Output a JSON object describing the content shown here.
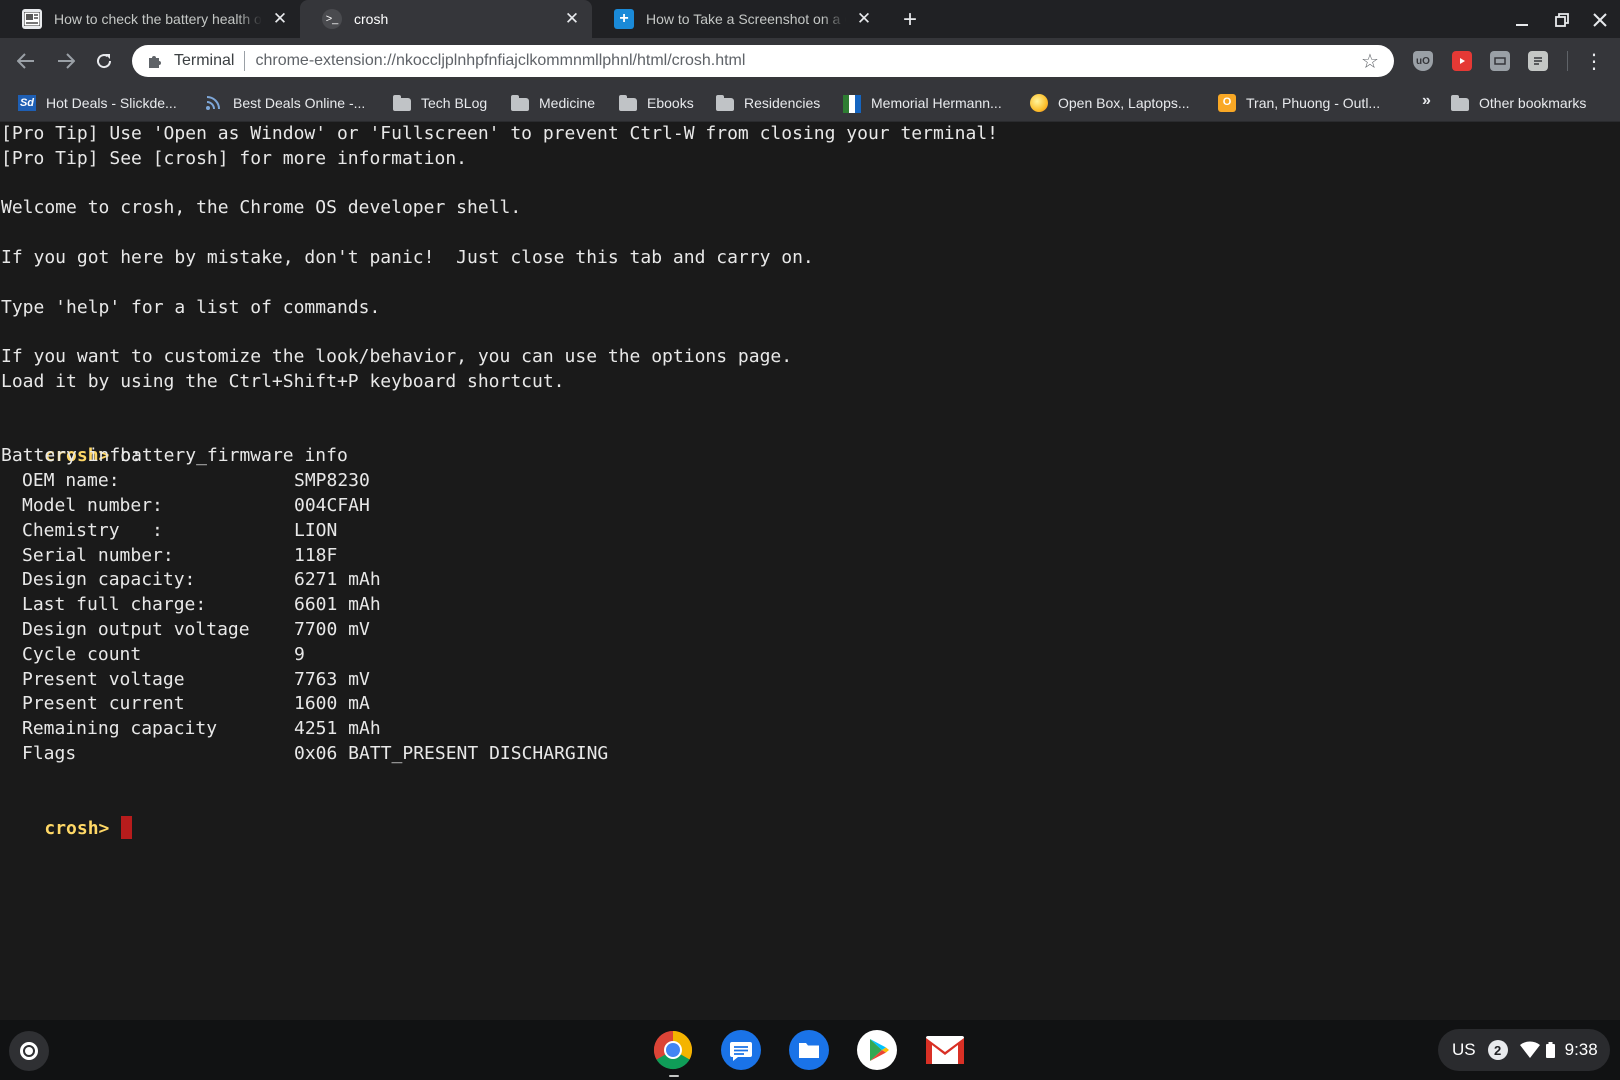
{
  "tabs": [
    {
      "title": "How to check the battery health of your Chromebook",
      "icon": "article-favicon-icon",
      "active": false
    },
    {
      "title": "crosh",
      "icon": "terminal-favicon-icon",
      "active": true
    },
    {
      "title": "How to Take a Screenshot on a Chromebook",
      "icon": "blue-plus-favicon-icon",
      "active": false
    }
  ],
  "toolbar": {
    "chip_label": "Terminal",
    "url": "chrome-extension://nkoccljplnhpfnfiajclkommnmllphnl/html/crosh.html"
  },
  "bookmarks": [
    {
      "label": "Hot Deals - Slickde...",
      "icon": "slickdeals-icon"
    },
    {
      "label": "Best Deals Online -...",
      "icon": "rss-feed-icon"
    },
    {
      "label": "Tech BLog",
      "icon": "folder-icon"
    },
    {
      "label": "Medicine",
      "icon": "folder-icon"
    },
    {
      "label": "Ebooks",
      "icon": "folder-icon"
    },
    {
      "label": "Residencies",
      "icon": "folder-icon"
    },
    {
      "label": "Memorial Hermann...",
      "icon": "memorial-hermann-icon"
    },
    {
      "label": "Open Box, Laptops...",
      "icon": "yellow-orb-icon"
    },
    {
      "label": "Tran, Phuong - Outl...",
      "icon": "outlook-icon"
    }
  ],
  "other_bookmarks": "Other bookmarks",
  "terminal": {
    "intro_lines": [
      "[Pro Tip] Use 'Open as Window' or 'Fullscreen' to prevent Ctrl-W from closing your terminal!",
      "[Pro Tip] See [crosh] for more information.",
      "",
      "Welcome to crosh, the Chrome OS developer shell.",
      "",
      "If you got here by mistake, don't panic!  Just close this tab and carry on.",
      "",
      "Type 'help' for a list of commands.",
      "",
      "If you want to customize the look/behavior, you can use the options page.",
      "Load it by using the Ctrl+Shift+P keyboard shortcut.",
      ""
    ],
    "prompt": "crosh>",
    "command": "battery_firmware info",
    "section_header": "Battery info:",
    "battery_info": [
      {
        "key": "OEM name:",
        "value": "SMP8230"
      },
      {
        "key": "Model number:",
        "value": "004CFAH"
      },
      {
        "key": "Chemistry   :",
        "value": "LION"
      },
      {
        "key": "Serial number:",
        "value": "118F"
      },
      {
        "key": "Design capacity:",
        "value": "6271 mAh"
      },
      {
        "key": "Last full charge:",
        "value": "6601 mAh"
      },
      {
        "key": "Design output voltage",
        "value": "7700 mV"
      },
      {
        "key": "Cycle count",
        "value": "9"
      },
      {
        "key": "Present voltage",
        "value": "7763 mV"
      },
      {
        "key": "Present current",
        "value": "1600 mA"
      },
      {
        "key": "Remaining capacity",
        "value": "4251 mAh"
      },
      {
        "key": "Flags",
        "value": "0x06 BATT_PRESENT DISCHARGING"
      }
    ]
  },
  "shelf": {
    "apps": [
      "chrome-icon",
      "messages-icon",
      "files-icon",
      "play-store-icon",
      "gmail-icon"
    ],
    "tray": {
      "ime": "US",
      "notifications": "2",
      "time": "9:38"
    }
  },
  "colors": {
    "prompt": "#ffd866",
    "cursor": "#b71c1c",
    "terminal_bg": "#1a1a1a"
  }
}
